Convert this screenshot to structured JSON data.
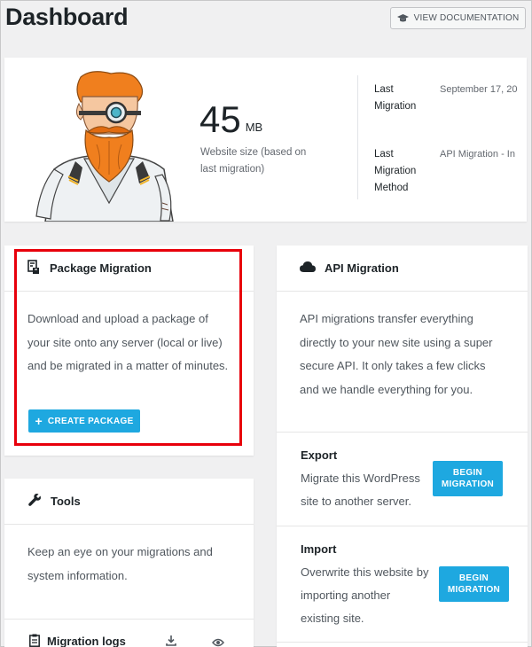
{
  "header": {
    "title": "Dashboard",
    "doc_button": "VIEW DOCUMENTATION"
  },
  "overview": {
    "size_value": "45",
    "size_unit": "MB",
    "size_caption": "Website size (based on last migration)",
    "last_migration_label": "Last Migration",
    "last_migration_value": "September 17, 20",
    "method_label": "Last Migration Method",
    "method_value": "API Migration - In"
  },
  "package_migration": {
    "title": "Package Migration",
    "description": "Download and upload a package of your site onto any server (local or live) and be migrated in a matter of minutes.",
    "button": "CREATE PACKAGE"
  },
  "api_migration": {
    "title": "API Migration",
    "description": "API migrations transfer everything directly to your new site using a super secure API. It only takes a few clicks and we handle everything for you.",
    "export_title": "Export",
    "export_text": "Migrate this WordPress site to another server.",
    "export_button": "BEGIN MIGRATION",
    "import_title": "Import",
    "import_text": "Overwrite this website by importing another existing site.",
    "import_button": "BEGIN MIGRATION"
  },
  "tools": {
    "title": "Tools",
    "description": "Keep an eye on your migrations and system information.",
    "logs_label": "Migration logs"
  },
  "colors": {
    "accent": "#1ea8e0",
    "highlight": "#e8000b",
    "background": "#f0f0f1"
  }
}
